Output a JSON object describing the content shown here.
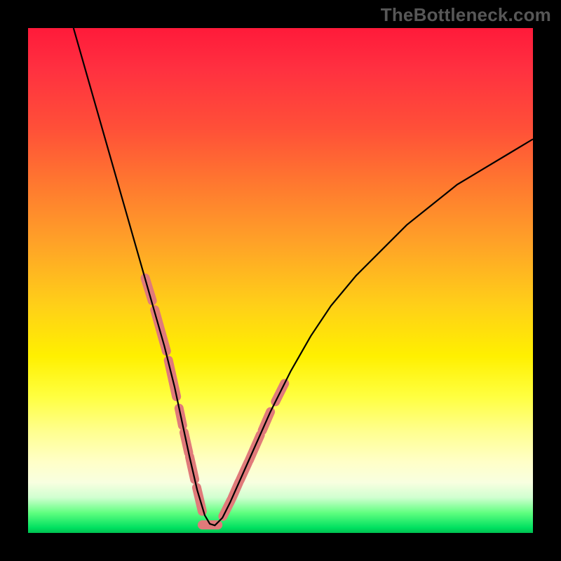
{
  "watermark": "TheBottleneck.com",
  "chart_data": {
    "type": "line",
    "title": "",
    "xlabel": "",
    "ylabel": "",
    "xlim": [
      0,
      100
    ],
    "ylim": [
      0,
      100
    ],
    "grid": false,
    "curve": {
      "x": [
        9,
        11,
        13,
        15,
        17,
        19,
        21,
        23,
        25,
        27,
        29,
        30.5,
        32,
        33.5,
        35,
        36,
        37,
        38.5,
        40,
        44,
        48,
        52,
        56,
        60,
        65,
        70,
        75,
        80,
        85,
        90,
        95,
        100
      ],
      "y": [
        100,
        93,
        86,
        79,
        72,
        65,
        58,
        51,
        44,
        37,
        29,
        22,
        15,
        8.5,
        3.5,
        1.8,
        1.5,
        3,
        6,
        15,
        24,
        32,
        39,
        45,
        51,
        56,
        61,
        65,
        69,
        72,
        75,
        78
      ],
      "stroke": "#000000",
      "width": 2.2
    },
    "highlight_segments": {
      "stroke": "#e07a7a",
      "width": 13,
      "cap": "round",
      "segments": [
        {
          "x": [
            23.2,
            24.6
          ],
          "y": [
            50.5,
            46.0
          ]
        },
        {
          "x": [
            25.1,
            27.4
          ],
          "y": [
            44.2,
            36.0
          ]
        },
        {
          "x": [
            27.8,
            29.4
          ],
          "y": [
            34.2,
            27.0
          ]
        },
        {
          "x": [
            29.9,
            30.6
          ],
          "y": [
            24.7,
            21.3
          ]
        },
        {
          "x": [
            30.9,
            31.8
          ],
          "y": [
            19.9,
            15.9
          ]
        },
        {
          "x": [
            32.0,
            33.0
          ],
          "y": [
            15.1,
            10.6
          ]
        },
        {
          "x": [
            33.4,
            34.5
          ],
          "y": [
            9.0,
            4.3
          ]
        },
        {
          "x": [
            34.5,
            37.6
          ],
          "y": [
            1.6,
            1.6
          ]
        },
        {
          "x": [
            38.6,
            40.2
          ],
          "y": [
            3.3,
            6.5
          ]
        },
        {
          "x": [
            40.4,
            41.8
          ],
          "y": [
            6.9,
            10.1
          ]
        },
        {
          "x": [
            42.0,
            43.6
          ],
          "y": [
            10.5,
            14.0
          ]
        },
        {
          "x": [
            43.8,
            46.0
          ],
          "y": [
            14.4,
            19.4
          ]
        },
        {
          "x": [
            46.4,
            48.0
          ],
          "y": [
            20.3,
            24.0
          ]
        },
        {
          "x": [
            49.0,
            50.8
          ],
          "y": [
            26.0,
            29.6
          ]
        }
      ]
    }
  }
}
